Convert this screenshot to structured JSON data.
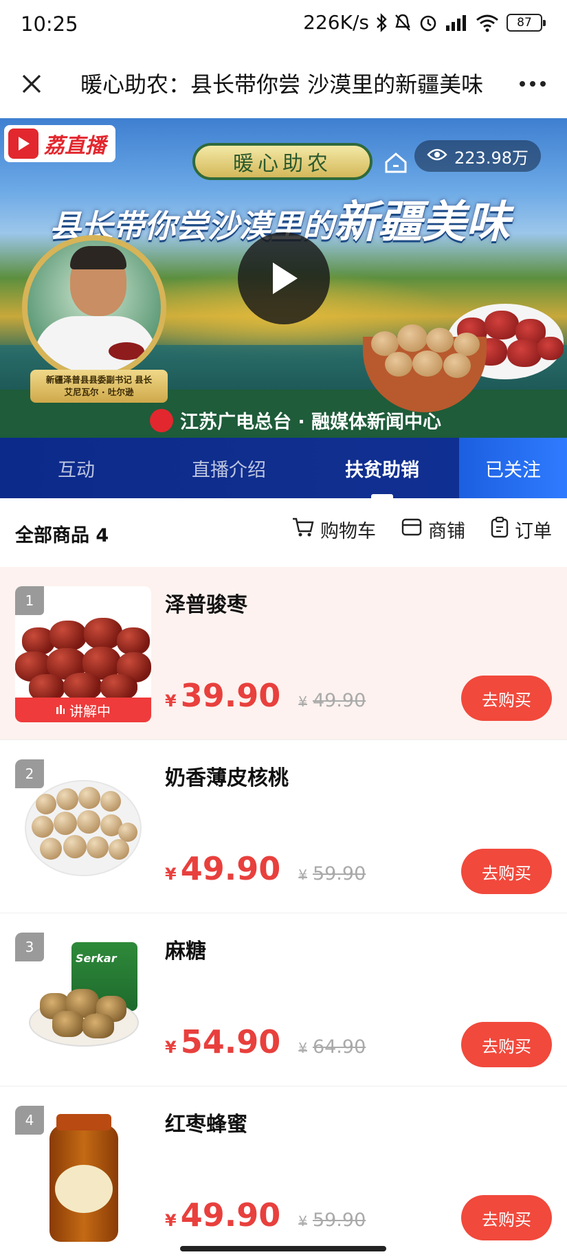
{
  "status_bar": {
    "time": "10:25",
    "network_speed": "226K/s",
    "battery": "87",
    "icons": [
      "bluetooth-icon",
      "mute-bell-icon",
      "alarm-icon",
      "signal-icon",
      "wifi-icon",
      "battery-icon"
    ]
  },
  "titlebar": {
    "title": "暖心助农：县长带你尝 沙漠里的新疆美味",
    "close_icon": "close-icon",
    "more_icon": "more-icon"
  },
  "banner": {
    "brand": "荔直播",
    "badge": "暖心助农",
    "views": "223.98万",
    "headline_part1": "县长带你尝沙漠里的",
    "headline_part2": "新疆美味",
    "caption_line1": "新疆泽普县县委副书记 县长",
    "caption_line2": "艾尼瓦尔 · 吐尔逊",
    "source": "江苏广电总台 · 融媒体新闻中心"
  },
  "tabs": [
    {
      "label": "互动",
      "active": false
    },
    {
      "label": "直播介绍",
      "active": false
    },
    {
      "label": "扶贫助销",
      "active": true
    }
  ],
  "follow_label": "已关注",
  "product_header": {
    "title": "全部商品 4",
    "cart": "购物车",
    "shop": "商铺",
    "orders": "订单"
  },
  "products": [
    {
      "rank": "1",
      "name": "泽普骏枣",
      "currency": "¥",
      "price": "39.90",
      "original_price": "49.90",
      "buy_label": "去购买",
      "live_tag": "讲解中",
      "highlight": true
    },
    {
      "rank": "2",
      "name": "奶香薄皮核桃",
      "currency": "¥",
      "price": "49.90",
      "original_price": "59.90",
      "buy_label": "去购买"
    },
    {
      "rank": "3",
      "name": "麻糖",
      "currency": "¥",
      "price": "54.90",
      "original_price": "64.90",
      "buy_label": "去购买"
    },
    {
      "rank": "4",
      "name": "红枣蜂蜜",
      "currency": "¥",
      "price": "49.90",
      "original_price": "59.90",
      "buy_label": "去购买"
    }
  ],
  "product_art": {
    "bag_label": "Serkar"
  },
  "colors": {
    "accent_red": "#f1493c",
    "tab_bg": "#0c2a8a",
    "follow_bg": "#2f7bff",
    "highlight_bg": "#fdf2ef"
  }
}
